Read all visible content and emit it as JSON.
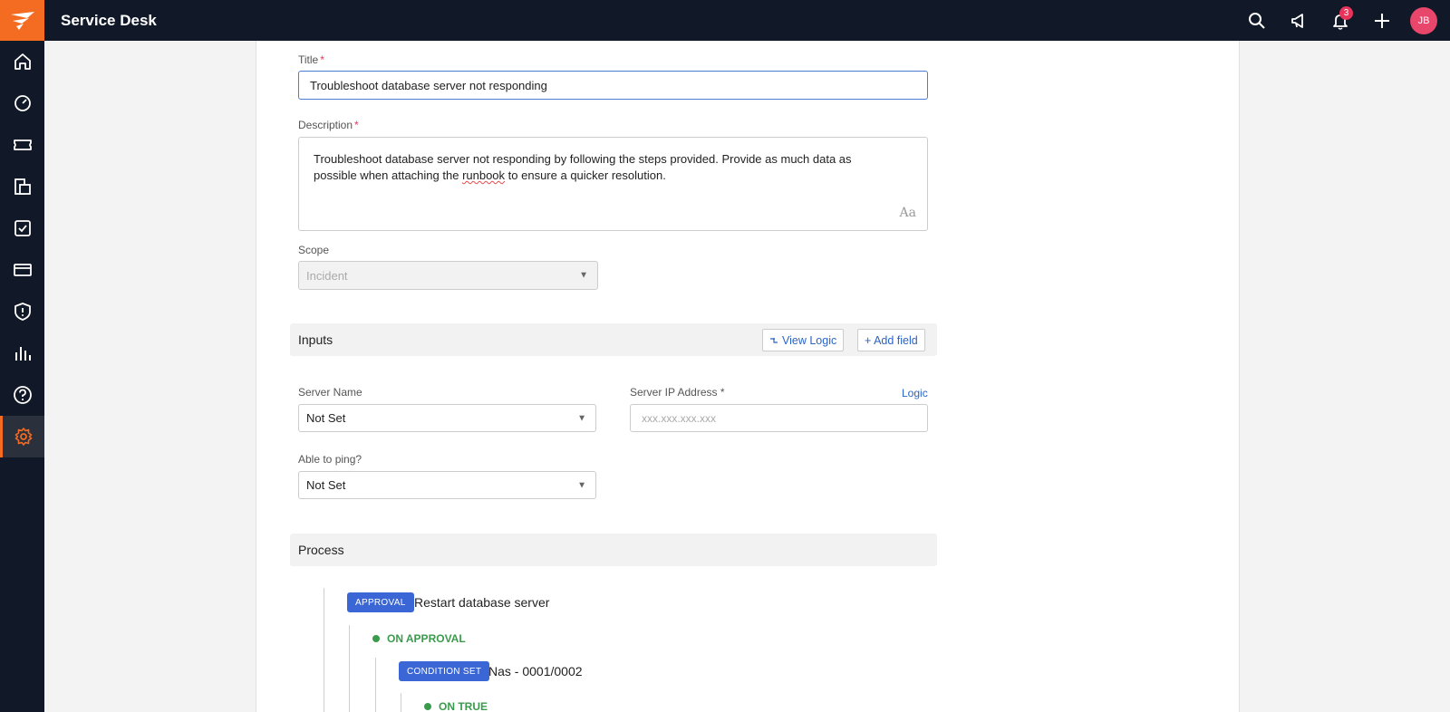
{
  "app": {
    "title": "Service Desk",
    "notification_count": "3",
    "user_initials": "JB"
  },
  "colors": {
    "accent": "#f36c21",
    "nav_bg": "#111827",
    "link": "#2b63c4",
    "tag": "#3b66d6",
    "success": "#3a9b4c"
  },
  "sidebar": {
    "items": [
      "home-icon",
      "dashboard-icon",
      "ticket-icon",
      "catalog-icon",
      "tasks-icon",
      "card-icon",
      "shield-icon",
      "reports-icon",
      "help-icon",
      "settings-icon"
    ]
  },
  "form": {
    "title_label": "Title",
    "title_value": "Troubleshoot database server not responding",
    "description_label": "Description",
    "description_line1": "Troubleshoot database server not responding by following the steps provided. Provide as much data as",
    "description_line2_pre": "possible when attaching the ",
    "description_spell": "runbook",
    "description_line2_post": " to ensure a quicker resolution.",
    "format_label": "Aa",
    "scope_label": "Scope",
    "scope_value": "Incident"
  },
  "inputs": {
    "header": "Inputs",
    "view_logic": "View Logic",
    "add_field": "+ Add field",
    "server_name_label": "Server Name",
    "server_name_value": "Not Set",
    "server_ip_label": "Server IP Address *",
    "server_ip_placeholder": "xxx.xxx.xxx.xxx",
    "logic_link": "Logic",
    "ping_label": "Able to ping?",
    "ping_value": "Not Set"
  },
  "process": {
    "header": "Process",
    "step1_tag": "APPROVAL",
    "step1_title": "Restart database server",
    "on_approval": "ON APPROVAL",
    "step2_tag": "CONDITION SET",
    "step2_title": "Nas - 0001/0002",
    "on_true": "ON TRUE"
  }
}
